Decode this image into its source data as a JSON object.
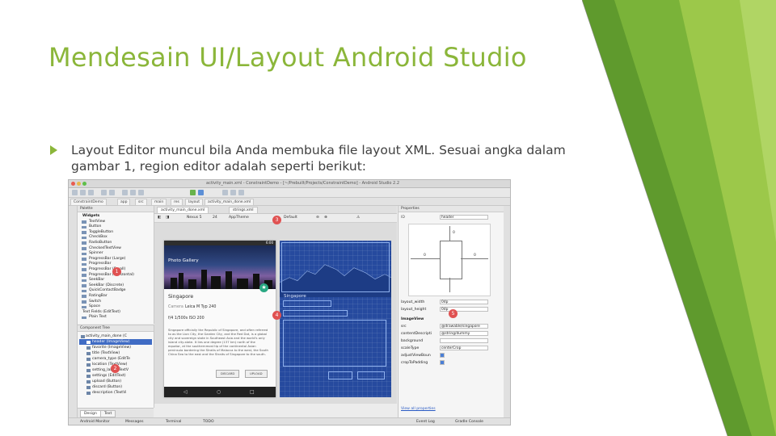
{
  "slide": {
    "title": "Mendesain UI/Layout Android Studio",
    "bullet": "Layout Editor muncul bila Anda membuka file layout XML. Sesuai angka dalam gambar 1, region editor adalah seperti berikut:"
  },
  "colors": {
    "accent_green": "#8bb63a",
    "deco_green_dark": "#5f9a2d",
    "deco_green_light": "#9cc84a",
    "marker_red": "#e05252",
    "blueprint_blue": "#264a9e"
  },
  "ide": {
    "window_title": "activity_main.xml - ConstraintDemo - [~/Prebuilt/Projects/ConstraintDemo] - Android Studio 2.2",
    "crumbs": [
      "ConstraintDemo",
      "app",
      "src",
      "main",
      "res",
      "layout",
      "activity_main_done.xml"
    ],
    "editor_tabs": [
      "activity_main_done.xml",
      "strings.xml"
    ],
    "toolbar": {
      "device": "Nexus 5",
      "api": "24",
      "theme": "AppTheme",
      "lang": "Default"
    },
    "palette_title": "Palette",
    "palette_group": "Widgets",
    "palette_items": [
      "TextView",
      "Button",
      "ToggleButton",
      "CheckBox",
      "RadioButton",
      "CheckedTextView",
      "Spinner",
      "ProgressBar (Large)",
      "ProgressBar",
      "ProgressBar (Small)",
      "ProgressBar (Horizontal)",
      "SeekBar",
      "SeekBar (Discrete)",
      "QuickContactBadge",
      "RatingBar",
      "Switch",
      "Space",
      "Text Fields (EditText)",
      "Plain Text"
    ],
    "tree_title": "Component Tree",
    "tree_items": [
      "activity_main_done (C",
      "header (ImageView)",
      "favorite (ImageView)",
      "title (TextView)",
      "camera_type (EditTe",
      "location (TextView)",
      "setting_label (TextV",
      "settings (EditText)",
      "upload (Button)",
      "discard (Button)",
      "description (TextVi"
    ],
    "design_tabs": [
      "Design",
      "Text"
    ],
    "phone": {
      "time": "6:00",
      "app_name": "Photo Gallery",
      "place": "Singapore",
      "camera_label": "Camera",
      "camera_value": "Leica M Typ 240",
      "settings_value": "f/4 1/500s  ISO 200",
      "description": "Singapore officially the Republic of Singapore, and often referred to as the Lion City, the Garden City, and the Red Dot, is a global city and sovereign state in Southeast Asia and the world's only island city-state. It lies one degree (137 km) north of the equator, at the southernmost tip of the continental Asian peninsula bordering the Straits of Malacca to the west, the South China Sea to the east and the Straits of Singapore to the south.",
      "discard_label": "DISCARD",
      "upload_label": "UPLOAD"
    },
    "blueprint_place": "Singapore",
    "properties_title": "Properties",
    "properties_id": "header",
    "constraint_margins": [
      "0",
      "0",
      "0"
    ],
    "props": [
      {
        "name": "layout_width",
        "value": "0dp"
      },
      {
        "name": "layout_height",
        "value": "0dp"
      },
      {
        "name": "ImageView",
        "value": ""
      },
      {
        "name": "src",
        "value": "@drawable/singapore"
      },
      {
        "name": "contentDescripti",
        "value": "@string/dummy"
      },
      {
        "name": "background",
        "value": ""
      },
      {
        "name": "scaleType",
        "value": "centerCrop"
      },
      {
        "name": "adjustViewBoun",
        "value": ""
      },
      {
        "name": "cropToPadding",
        "value": ""
      }
    ],
    "view_all": "View all properties",
    "bottom_left": [
      "Android Monitor",
      "Messages",
      "Terminal",
      "TODO"
    ],
    "bottom_right": [
      "Event Log",
      "Gradle Console"
    ],
    "markers": [
      "1",
      "2",
      "3",
      "4",
      "5"
    ]
  }
}
